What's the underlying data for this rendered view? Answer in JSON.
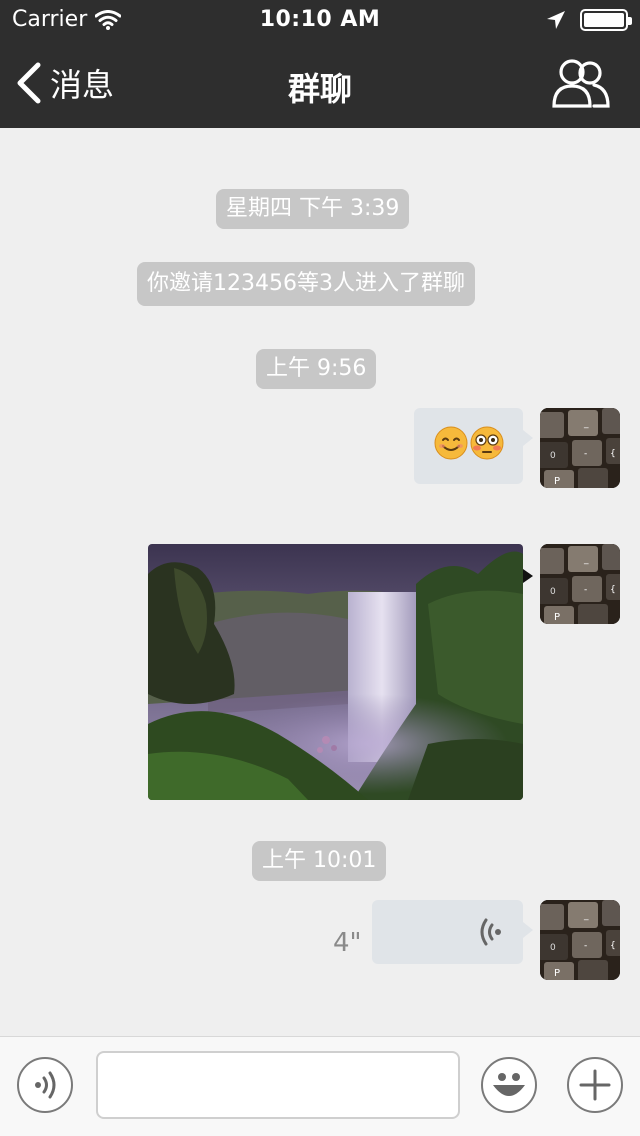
{
  "status_bar": {
    "carrier": "Carrier",
    "time": "10:10 AM"
  },
  "nav": {
    "back_label": "消息",
    "title": "群聊"
  },
  "messages": [
    {
      "type": "system",
      "text": "星期四 下午 3:39"
    },
    {
      "type": "system",
      "text": "你邀请123456等3人进入了群聊"
    },
    {
      "type": "system",
      "text": "上午 9:56"
    },
    {
      "type": "emoji",
      "sender": "me",
      "emojis": [
        "smiling-face-icon",
        "flushed-face-icon"
      ]
    },
    {
      "type": "image",
      "sender": "me",
      "subject": "waterfall-photo"
    },
    {
      "type": "system",
      "text": "上午 10:01"
    },
    {
      "type": "voice",
      "sender": "me",
      "duration": "4\""
    }
  ],
  "input": {
    "placeholder": ""
  },
  "colors": {
    "nav_bg": "#2e2e2e",
    "chat_bg": "#efefef",
    "system_pill": "#c7c7c7",
    "bubble": "#e0e4e8"
  }
}
